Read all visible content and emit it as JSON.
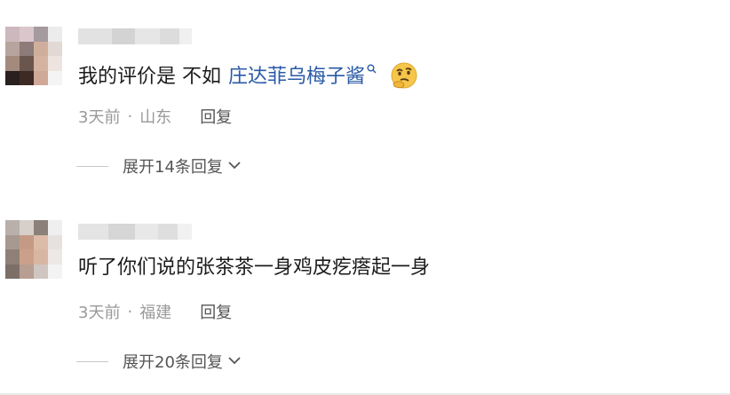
{
  "comments": [
    {
      "text_before": "我的评价是 不如",
      "link_text": "庄达菲乌梅子酱",
      "search_icon": "magnifier-icon",
      "emoji_icon": "thinking-face-icon",
      "time": "3天前",
      "separator": "·",
      "location": "山东",
      "reply_label": "回复",
      "expand_label": "展开14条回复"
    },
    {
      "text_before": "听了你们说的张茶茶一身鸡皮疙瘩起一身",
      "time": "3天前",
      "separator": "·",
      "location": "福建",
      "reply_label": "回复",
      "expand_label": "展开20条回复"
    }
  ],
  "colors": {
    "link": "#2a5aa6",
    "meta": "#9a9a9a",
    "reply": "#555555",
    "avatar1": [
      "#cdb8bd",
      "#d9c7cb",
      "#a59a9e",
      "#ececec",
      "#b8a49f",
      "#8c7b78",
      "#cfaf9c",
      "#e2d8d4",
      "#a48a7d",
      "#6b564e",
      "#d4b3a0",
      "#ede3df",
      "#2a2020",
      "#3d2a24",
      "#cfa898",
      "#f4f4f4"
    ],
    "avatar2": [
      "#b9b0ab",
      "#d7cfca",
      "#8c817a",
      "#efefef",
      "#a89990",
      "#c49a84",
      "#dcbba8",
      "#e6e1de",
      "#8f7f76",
      "#caa08a",
      "#d8b6a3",
      "#ede8e6",
      "#7c6f68",
      "#b79e91",
      "#cfc6c1",
      "#f3f3f3"
    ]
  }
}
